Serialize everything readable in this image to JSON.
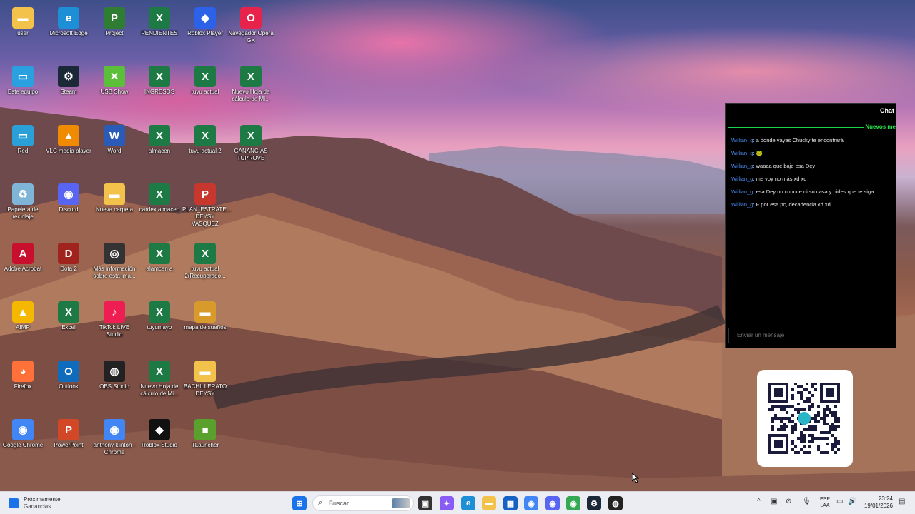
{
  "desktop_icons": [
    {
      "label": "user",
      "color": "#f2c24a",
      "glyph": "▬",
      "icon": "folder-icon"
    },
    {
      "label": "Microsoft Edge",
      "color": "#1c8fd6",
      "glyph": "e",
      "icon": "edge-icon"
    },
    {
      "label": "Project",
      "color": "#2e7d32",
      "glyph": "P",
      "icon": "project-icon"
    },
    {
      "label": "PENDIENTES",
      "color": "#1e7a44",
      "glyph": "X",
      "icon": "excel-icon"
    },
    {
      "label": "Roblox Player",
      "color": "#2b62e8",
      "glyph": "◆",
      "icon": "roblox-icon"
    },
    {
      "label": "Navegador Opera GX",
      "color": "#e8234b",
      "glyph": "O",
      "icon": "opera-gx-icon"
    },
    {
      "label": "Este equipo",
      "color": "#2aa0e0",
      "glyph": "▭",
      "icon": "computer-icon"
    },
    {
      "label": "Steam",
      "color": "#1b2838",
      "glyph": "⚙",
      "icon": "steam-icon"
    },
    {
      "label": "USB Show",
      "color": "#5cbf3a",
      "glyph": "✕",
      "icon": "usb-show-icon"
    },
    {
      "label": "INGRESOS",
      "color": "#1e7a44",
      "glyph": "X",
      "icon": "excel-icon"
    },
    {
      "label": "tuyu actual",
      "color": "#1e7a44",
      "glyph": "X",
      "icon": "excel-icon"
    },
    {
      "label": "Nuevo Hoja de cálculo de Mi...",
      "color": "#1e7a44",
      "glyph": "X",
      "icon": "excel-icon"
    },
    {
      "label": "Red",
      "color": "#2a9fd8",
      "glyph": "▭",
      "icon": "network-icon"
    },
    {
      "label": "VLC media player",
      "color": "#f08a00",
      "glyph": "▲",
      "icon": "vlc-icon"
    },
    {
      "label": "Word",
      "color": "#2b5bb8",
      "glyph": "W",
      "icon": "word-icon"
    },
    {
      "label": "almacen",
      "color": "#1e7a44",
      "glyph": "X",
      "icon": "excel-icon"
    },
    {
      "label": "tuyu actual 2",
      "color": "#1e7a44",
      "glyph": "X",
      "icon": "excel-icon"
    },
    {
      "label": "GANANCIAS TUPROVE",
      "color": "#1e7a44",
      "glyph": "X",
      "icon": "excel-icon"
    },
    {
      "label": "Papelera de reciclaje",
      "color": "#7fb6d8",
      "glyph": "♻",
      "icon": "recycle-bin-icon"
    },
    {
      "label": "Discord",
      "color": "#5865f2",
      "glyph": "◉",
      "icon": "discord-icon"
    },
    {
      "label": "Nueva carpeta",
      "color": "#f2c24a",
      "glyph": "▬",
      "icon": "folder-icon"
    },
    {
      "label": "cardex almacen",
      "color": "#1e7a44",
      "glyph": "X",
      "icon": "excel-icon"
    },
    {
      "label": "PLAN_ESTRATE... DEYSY VASQUEZ",
      "color": "#c8372d",
      "glyph": "P",
      "icon": "powerpoint-file-icon"
    },
    {
      "label": "",
      "color": "",
      "glyph": "",
      "icon": ""
    },
    {
      "label": "Adobe Acrobat",
      "color": "#c8102e",
      "glyph": "A",
      "icon": "acrobat-icon"
    },
    {
      "label": "Dota 2",
      "color": "#a0241d",
      "glyph": "D",
      "icon": "dota2-icon"
    },
    {
      "label": "Más información sobre esta ima...",
      "color": "#333333",
      "glyph": "◎",
      "icon": "camera-info-icon"
    },
    {
      "label": "alamcen a",
      "color": "#1e7a44",
      "glyph": "X",
      "icon": "excel-icon"
    },
    {
      "label": "tuyu actual 2(Recuperado...",
      "color": "#1e7a44",
      "glyph": "X",
      "icon": "excel-icon"
    },
    {
      "label": "",
      "color": "",
      "glyph": "",
      "icon": ""
    },
    {
      "label": "AIMP",
      "color": "#f5b800",
      "glyph": "▲",
      "icon": "aimp-icon"
    },
    {
      "label": "Excel",
      "color": "#1e7a44",
      "glyph": "X",
      "icon": "excel-app-icon"
    },
    {
      "label": "TikTok LIVE Studio",
      "color": "#ee1d52",
      "glyph": "♪",
      "icon": "tiktok-live-icon"
    },
    {
      "label": "tuyumayo",
      "color": "#1e7a44",
      "glyph": "X",
      "icon": "excel-icon"
    },
    {
      "label": "mapa de sueños",
      "color": "#d89a2a",
      "glyph": "▬",
      "icon": "image-file-icon"
    },
    {
      "label": "",
      "color": "",
      "glyph": "",
      "icon": ""
    },
    {
      "label": "Firefox",
      "color": "#ff7139",
      "glyph": "◕",
      "icon": "firefox-icon"
    },
    {
      "label": "Outlook",
      "color": "#0f6cbd",
      "glyph": "O",
      "icon": "outlook-icon"
    },
    {
      "label": "OBS Studio",
      "color": "#222222",
      "glyph": "◍",
      "icon": "obs-icon"
    },
    {
      "label": "Nuevo Hoja de cálculo de Mi...",
      "color": "#1e7a44",
      "glyph": "X",
      "icon": "excel-icon"
    },
    {
      "label": "BACHILLERATO DEYSY",
      "color": "#f2c24a",
      "glyph": "▬",
      "icon": "folder-icon"
    },
    {
      "label": "",
      "color": "",
      "glyph": "",
      "icon": ""
    },
    {
      "label": "Google Chrome",
      "color": "#4285f4",
      "glyph": "◉",
      "icon": "chrome-icon"
    },
    {
      "label": "PowerPoint",
      "color": "#d24726",
      "glyph": "P",
      "icon": "powerpoint-icon"
    },
    {
      "label": "anthony klinton - Chrome",
      "color": "#4285f4",
      "glyph": "◉",
      "icon": "chrome-profile-icon"
    },
    {
      "label": "Roblox Studio",
      "color": "#111111",
      "glyph": "◆",
      "icon": "roblox-studio-icon"
    },
    {
      "label": "TLauncher",
      "color": "#5aa02c",
      "glyph": "■",
      "icon": "tlauncher-icon"
    }
  ],
  "chat": {
    "title": "Chat",
    "new_messages_label": "Nuevos me",
    "messages": [
      {
        "user": "Willian_g",
        "text": ": a donde vayas Chucky te encontrará"
      },
      {
        "user": "Willian_g",
        "text": ": 🐸"
      },
      {
        "user": "Willian_g",
        "text": ": waaaa que baje esa Dey"
      },
      {
        "user": "Willian_g",
        "text": ": me voy no más xd xd"
      },
      {
        "user": "Willian_g",
        "text": ": esa Dey no conoce ni su casa y pides que te siga"
      },
      {
        "user": "Willian_g",
        "text": ": F por esa pc, decadencia xd xd"
      }
    ],
    "input_placeholder": "Enviar un mensaje"
  },
  "taskbar": {
    "widget_line1": "Próximamente",
    "widget_line2": "Ganancias",
    "search_placeholder": "Buscar",
    "lang_line1": "ESP",
    "lang_line2": "LAA",
    "time": "23:24",
    "date": "19/01/2026",
    "pinned": [
      {
        "icon": "start-icon",
        "color": "#1a73e8",
        "glyph": "⊞"
      },
      {
        "icon": "task-view-icon",
        "color": "#333333",
        "glyph": "▣"
      },
      {
        "icon": "copilot-icon",
        "color": "#8a5cf6",
        "glyph": "✦"
      },
      {
        "icon": "edge-taskbar-icon",
        "color": "#1c8fd6",
        "glyph": "e"
      },
      {
        "icon": "file-explorer-icon",
        "color": "#f2c24a",
        "glyph": "▬"
      },
      {
        "icon": "store-icon",
        "color": "#1662c4",
        "glyph": "▦"
      },
      {
        "icon": "chrome-taskbar-icon",
        "color": "#4285f4",
        "glyph": "◉"
      },
      {
        "icon": "discord-taskbar-icon",
        "color": "#5865f2",
        "glyph": "◉"
      },
      {
        "icon": "chrome-profile-taskbar-icon",
        "color": "#34a853",
        "glyph": "◉"
      },
      {
        "icon": "steam-taskbar-icon",
        "color": "#1b2838",
        "glyph": "⚙"
      },
      {
        "icon": "obs-taskbar-icon",
        "color": "#222222",
        "glyph": "◍"
      }
    ]
  }
}
